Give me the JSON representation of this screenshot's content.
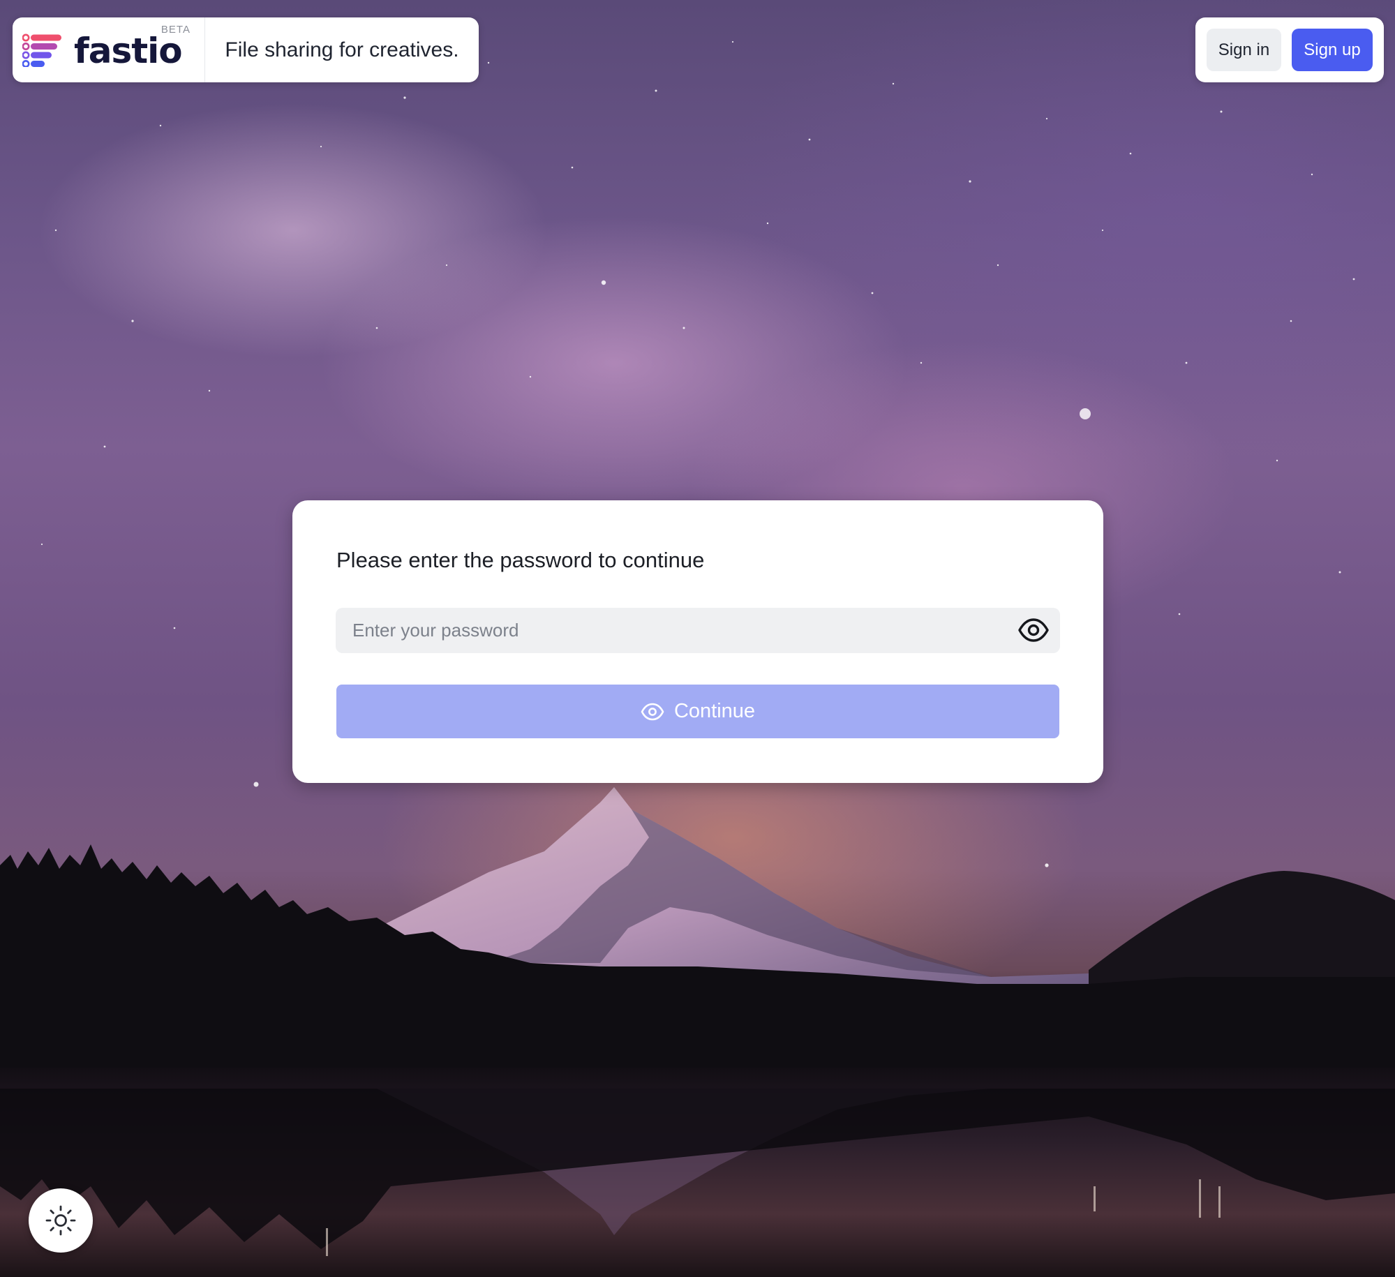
{
  "header": {
    "brand_name": "fastio",
    "beta_label": "BETA",
    "tagline": "File sharing for creatives.",
    "brand_colors": [
      "#ef4f6d",
      "#8b5cf6",
      "#4a5cf0",
      "#15173a"
    ]
  },
  "auth": {
    "sign_in_label": "Sign in",
    "sign_up_label": "Sign up",
    "accent_color": "#4a5cf0"
  },
  "dialog": {
    "title": "Please enter the password to continue",
    "password_placeholder": "Enter your password",
    "password_value": "",
    "show_password_icon": "eye-icon",
    "continue_label": "Continue",
    "continue_icon": "eye-icon",
    "continue_color": "#a1abf4",
    "continue_disabled": true
  },
  "theme_toggle": {
    "icon": "sun-icon"
  },
  "background": {
    "subject": "milky-way-night-sky-over-snowy-mountain-and-lake"
  }
}
